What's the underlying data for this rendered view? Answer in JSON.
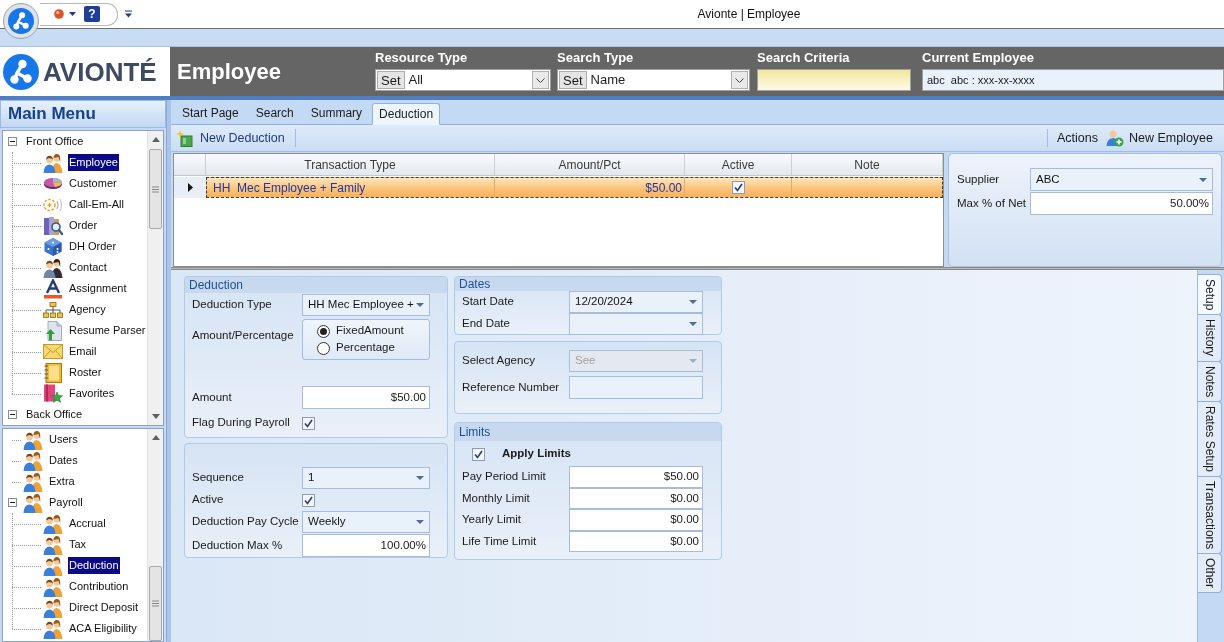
{
  "window": {
    "title": "Avionte | Employee",
    "help_button": "?"
  },
  "header": {
    "brand": "AVIONTÉ",
    "module": "Employee",
    "fields": [
      {
        "kind": "combo",
        "label": "Resource Type",
        "button": "Set",
        "value": "All"
      },
      {
        "kind": "combo",
        "label": "Search Type",
        "button": "Set",
        "value": "Name"
      },
      {
        "kind": "search",
        "label": "Search Criteria"
      },
      {
        "kind": "display",
        "label": "Current Employee",
        "value": "abc  abc : xxx-xx-xxxx"
      }
    ]
  },
  "sidebar": {
    "title": "Main Menu",
    "trees": [
      {
        "items": [
          {
            "label": "Front Office",
            "expanded": true,
            "selected": false,
            "children": [
              {
                "label": "Employee",
                "selected": true
              },
              {
                "label": "Customer",
                "selected": false
              },
              {
                "label": "Call-Em-All",
                "selected": false
              },
              {
                "label": "Order",
                "selected": false
              },
              {
                "label": "DH Order",
                "selected": false
              },
              {
                "label": "Contact",
                "selected": false
              },
              {
                "label": "Assignment",
                "selected": false
              },
              {
                "label": "Agency",
                "selected": false
              },
              {
                "label": "Resume Parser",
                "selected": false
              },
              {
                "label": "Email",
                "selected": false
              },
              {
                "label": "Roster",
                "selected": false
              },
              {
                "label": "Favorites",
                "selected": false
              }
            ]
          },
          {
            "label": "Back Office",
            "expanded": true,
            "selected": false
          }
        ]
      },
      {
        "items": [
          {
            "label": "Users",
            "selected": false
          },
          {
            "label": "Dates",
            "selected": false
          },
          {
            "label": "Extra",
            "selected": false
          },
          {
            "label": "Payroll",
            "expanded": true,
            "selected": false,
            "children": [
              {
                "label": "Accrual",
                "selected": false
              },
              {
                "label": "Tax",
                "selected": false
              },
              {
                "label": "Deduction",
                "selected": true
              },
              {
                "label": "Contribution",
                "selected": false
              },
              {
                "label": "Direct Deposit",
                "selected": false
              },
              {
                "label": "ACA Eligibility",
                "selected": false
              }
            ]
          }
        ]
      }
    ]
  },
  "tabs": [
    {
      "label": "Start Page",
      "selected": false
    },
    {
      "label": "Search",
      "selected": false
    },
    {
      "label": "Summary",
      "selected": false
    },
    {
      "label": "Deduction",
      "selected": true
    }
  ],
  "toolbar": {
    "left": [
      {
        "label": "New Deduction"
      }
    ],
    "right": [
      {
        "label": "Actions"
      },
      {
        "label": "New Employee"
      }
    ]
  },
  "grid": {
    "columns": [
      "Transaction Type",
      "Amount/Pct",
      "Active",
      "Note"
    ],
    "rows": [
      {
        "transaction_type": "HH  Mec Employee + Family",
        "amount_pct": "$50.00",
        "active": true,
        "selected": true
      }
    ]
  },
  "details": {
    "fields": [
      {
        "kind": "dropdown",
        "label": "Supplier",
        "value": "ABC",
        "disabled": false
      },
      {
        "kind": "text",
        "label": "Max % of Net",
        "value": "50.00%",
        "disabled": false
      }
    ]
  },
  "form": {
    "columns": [
      [
        {
          "title": "Deduction",
          "fields": [
            {
              "kind": "dropdown",
              "label": "Deduction Type",
              "value": "HH Mec Employee +",
              "disabled": false
            },
            {
              "kind": "radio",
              "label": "Amount/Percentage",
              "options": [
                {
                  "label": "FixedAmount",
                  "selected": true
                },
                {
                  "label": "Percentage",
                  "selected": false
                }
              ]
            },
            {
              "kind": "text",
              "label": "Amount",
              "value": "$50.00",
              "disabled": false
            },
            {
              "kind": "checkbox",
              "label": "Flag During Payroll",
              "checked": true
            }
          ]
        },
        {
          "fields": [
            {
              "kind": "dropdown",
              "label": "Sequence",
              "value": "1",
              "disabled": false
            },
            {
              "kind": "checkbox",
              "label": "Active",
              "checked": true
            },
            {
              "kind": "dropdown",
              "label": "Deduction Pay Cycle",
              "value": "Weekly",
              "disabled": false
            },
            {
              "kind": "text",
              "label": "Deduction Max %",
              "value": "100.00%",
              "disabled": false
            }
          ]
        }
      ],
      [
        {
          "title": "Dates",
          "fields": [
            {
              "kind": "dropdown",
              "label": "Start Date",
              "value": "12/20/2024",
              "disabled": false
            },
            {
              "kind": "dropdown",
              "label": "End Date",
              "disabled": false
            }
          ]
        },
        {
          "fields": [
            {
              "kind": "dropdown",
              "label": "Select Agency",
              "value": "See",
              "disabled": true
            },
            {
              "kind": "text",
              "label": "Reference Number",
              "disabled": true
            }
          ]
        },
        {
          "title": "Limits",
          "fields": [
            {
              "kind": "check_option",
              "label": "Apply Limits",
              "checked": true
            },
            {
              "kind": "text",
              "label": "Pay Period Limit",
              "value": "$50.00",
              "disabled": false
            },
            {
              "kind": "text",
              "label": "Monthly Limit",
              "value": "$0.00",
              "disabled": false
            },
            {
              "kind": "text",
              "label": "Yearly Limit",
              "value": "$0.00",
              "disabled": false
            },
            {
              "kind": "text",
              "label": "Life Time Limit",
              "value": "$0.00",
              "disabled": false
            }
          ]
        }
      ]
    ]
  },
  "side_tabs": [
    {
      "label": "Setup",
      "selected": true
    },
    {
      "label": "History",
      "selected": false
    },
    {
      "label": "Notes",
      "selected": false
    },
    {
      "label": "Rates Setup",
      "selected": false
    },
    {
      "label": "Transactions",
      "selected": false
    },
    {
      "label": "Other",
      "selected": false
    }
  ]
}
